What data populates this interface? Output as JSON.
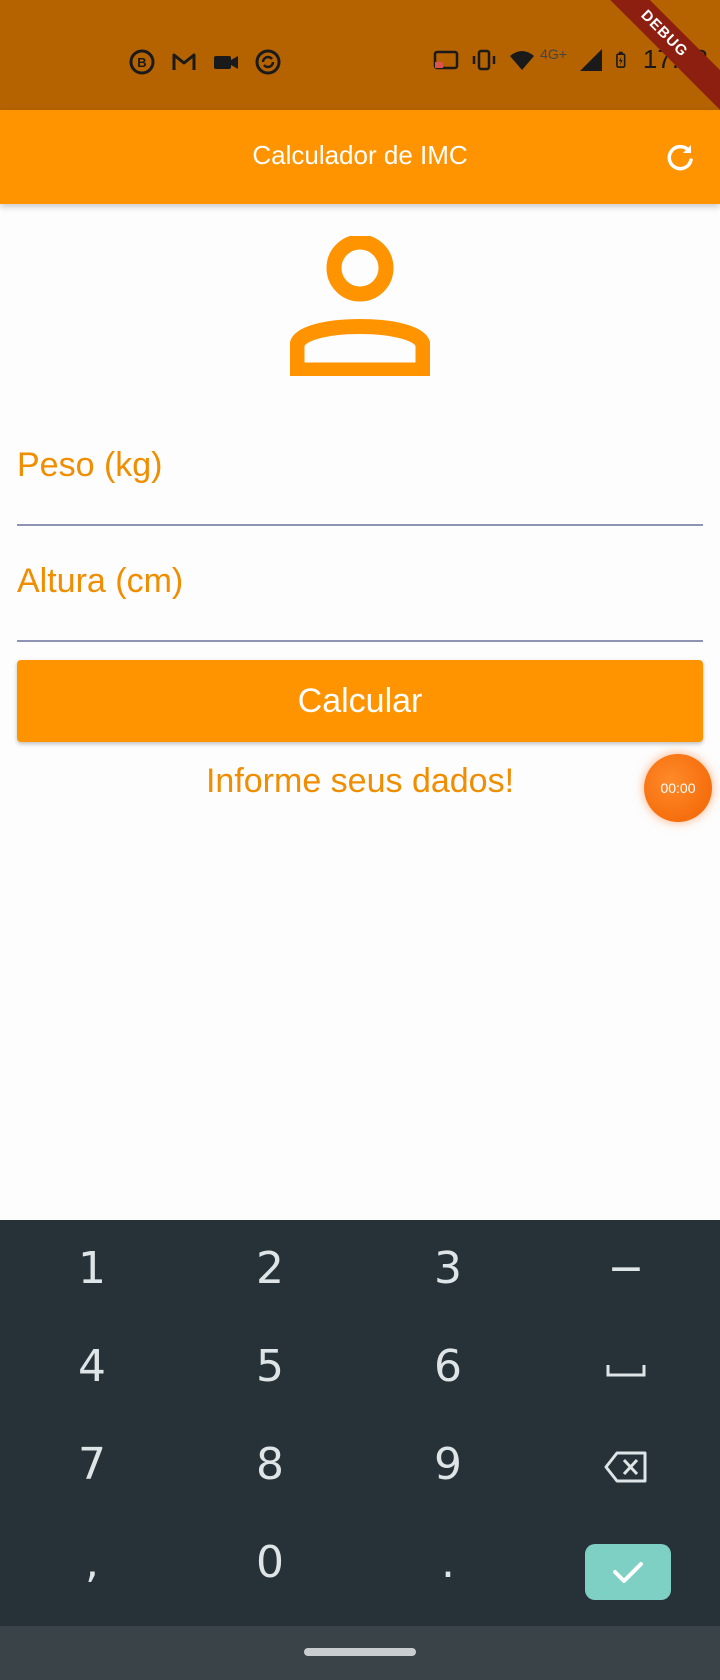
{
  "status_bar": {
    "time": "17:53",
    "network_label": "4G+",
    "debug_label": "DEBUG",
    "left_icons": [
      "b-badge-icon",
      "gmail-icon",
      "video-camera-icon",
      "sync-circle-icon"
    ],
    "right_icons": [
      "cast-icon",
      "vibrate-icon",
      "wifi-icon",
      "signal-icon",
      "battery-icon"
    ]
  },
  "app_bar": {
    "title": "Calculador de IMC",
    "action_icon": "refresh-icon"
  },
  "form": {
    "avatar_icon": "person-outline-icon",
    "weight": {
      "label": "Peso (kg)",
      "value": ""
    },
    "height": {
      "label": "Altura (cm)",
      "value": ""
    },
    "calculate_label": "Calcular",
    "info_text": "Informe seus dados!"
  },
  "timer_bubble": {
    "text": "00:00"
  },
  "keyboard": {
    "rows": [
      [
        "1",
        "2",
        "3",
        "−"
      ],
      [
        "4",
        "5",
        "6",
        "␣"
      ],
      [
        "7",
        "8",
        "9",
        "⌫"
      ],
      [
        ",",
        "0",
        ".",
        "✓"
      ]
    ]
  },
  "colors": {
    "accent": "#ff9400",
    "accent_text": "#f08d00",
    "status_bar": "#b56300",
    "keyboard_bg": "#263238",
    "done_key": "#7ecfc4"
  }
}
